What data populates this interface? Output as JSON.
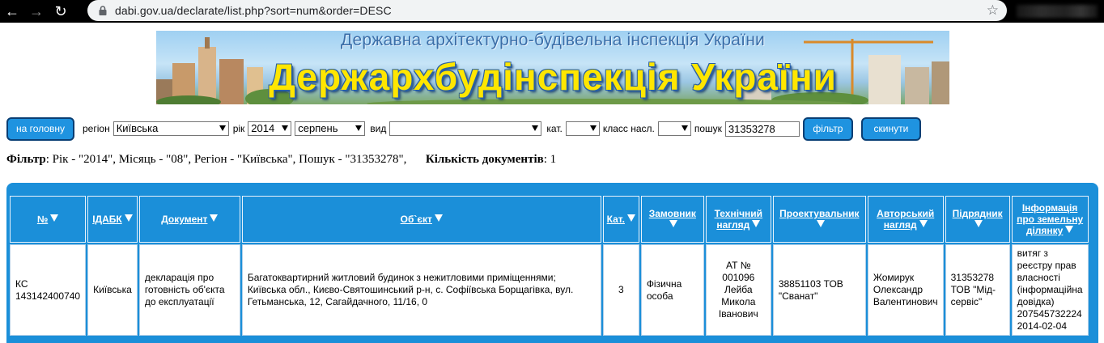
{
  "browser": {
    "url": "dabi.gov.ua/declarate/list.php?sort=num&order=DESC"
  },
  "banner": {
    "subtitle": "Державна архітектурно-будівельна інспекція України",
    "title": "Держархбудінспекція України"
  },
  "filters": {
    "home_label": "на головну",
    "region_label": "регіон",
    "region_value": "Київська",
    "year_label": "рік",
    "year_value": "2014",
    "month_value": "серпень",
    "type_label": "вид",
    "type_value": "",
    "category_label": "кат.",
    "category_value": "",
    "class_label": "класс насл.",
    "class_value": "",
    "search_label": "пошук",
    "search_value": "31353278",
    "filter_button": "фільтр",
    "reset_button": "скинути"
  },
  "summary": {
    "filter_label": "Фільтр",
    "filter_text": ": Рік - \"2014\", Місяць - \"08\", Регіон - \"Київська\", Пошук - \"31353278\",",
    "count_label": "Кількість документів",
    "count_value": ": 1"
  },
  "table": {
    "headers": [
      {
        "label": "№"
      },
      {
        "label": "ІДАБК"
      },
      {
        "label": "Документ"
      },
      {
        "label": "Об`єкт"
      },
      {
        "label": "Кат."
      },
      {
        "label": "Замовник"
      },
      {
        "label": "Технічний нагляд"
      },
      {
        "label": "Проектувальник"
      },
      {
        "label": "Авторський нагляд"
      },
      {
        "label": "Підрядник"
      },
      {
        "label": "Інформація про земельну ділянку"
      }
    ],
    "rows": [
      {
        "num": "КС 143142400740",
        "idabk": "Київська",
        "document": "декларація про готовність об'єкта до експлуатації",
        "object": "Багатоквартирний житловий будинок з нежитловими приміщеннями; Київська обл., Києво-Святошинський р-н, с. Софіївська Борщагівка, вул. Гетьманська, 12, Сагайдачного, 11/16, 0",
        "category": "3",
        "customer": "Фізична особа",
        "tech_supervision": "АТ № 001096 Лейба Микола Іванович",
        "designer": "38851103 ТОВ \"Сванат\"",
        "author_supervision": "Жомирук Олександр Валентинович",
        "contractor": "31353278 ТОВ \"Мід-сервіс\"",
        "land_info": "витяг з реєстру прав власності (інформаційна довідка) 207545732224 2014-02-04"
      }
    ]
  }
}
